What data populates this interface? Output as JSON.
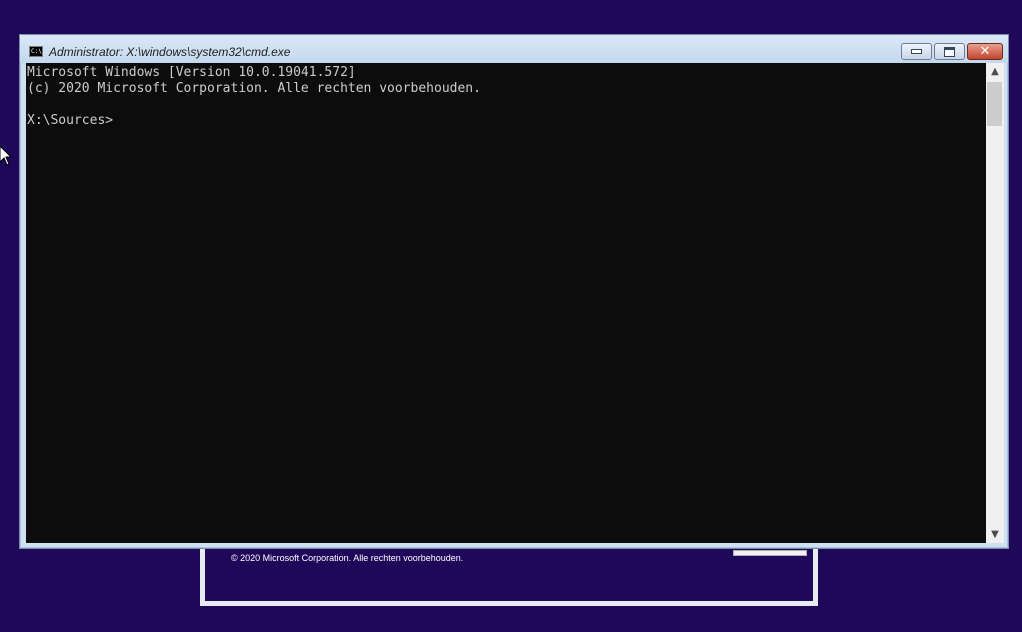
{
  "window": {
    "title": "Administrator: X:\\windows\\system32\\cmd.exe",
    "icon_label": "C:\\",
    "controls": {
      "minimize": "minimize-icon",
      "maximize": "maximize-icon",
      "close_glyph": "✕"
    }
  },
  "console": {
    "lines": [
      "Microsoft Windows [Version 10.0.19041.572]",
      "(c) 2020 Microsoft Corporation. Alle rechten voorbehouden.",
      "",
      "X:\\Sources>"
    ]
  },
  "scrollbar": {
    "up_glyph": "▲",
    "down_glyph": "▼"
  },
  "background_dialog": {
    "copyright": "© 2020 Microsoft Corporation. Alle rechten voorbehouden."
  },
  "colors": {
    "desktop": "#1f0859",
    "console_bg": "#0c0c0c",
    "console_fg": "#cccccc"
  }
}
